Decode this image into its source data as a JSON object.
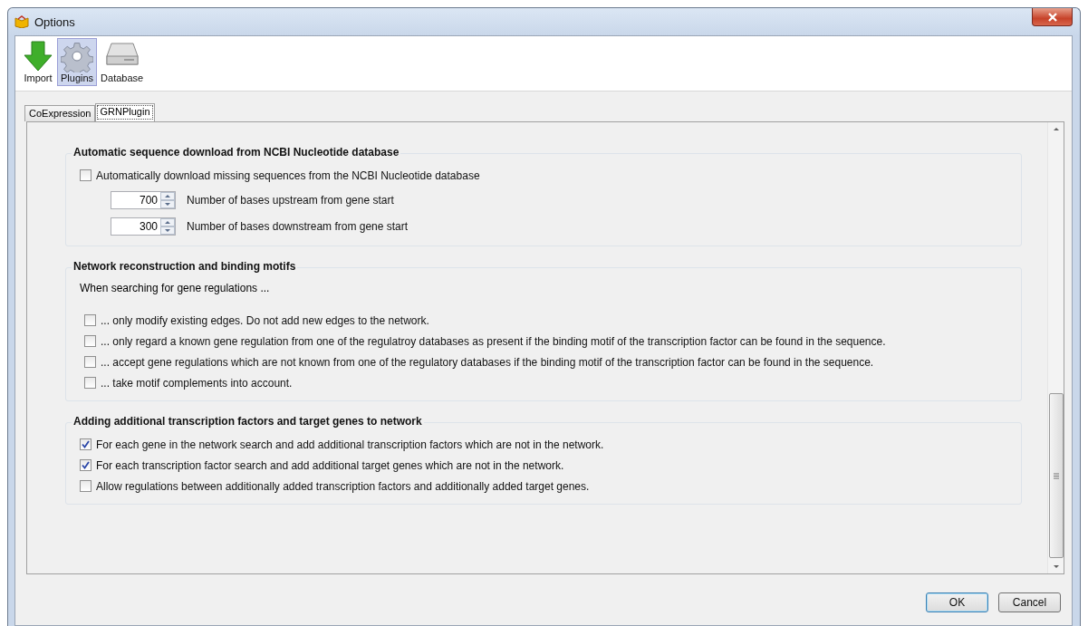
{
  "window": {
    "title": "Options"
  },
  "toolbar": [
    {
      "label": "Import",
      "kind": "import",
      "selected": false
    },
    {
      "label": "Plugins",
      "kind": "plugins",
      "selected": true
    },
    {
      "label": "Database",
      "kind": "database",
      "selected": false
    }
  ],
  "tabs": [
    {
      "label": "CoExpression",
      "selected": false
    },
    {
      "label": "GRNPlugin",
      "selected": true
    }
  ],
  "groups": [
    {
      "title": "Automatic sequence download from NCBI Nucleotide database",
      "items": [
        {
          "kind": "checkbox",
          "label": "Automatically download missing sequences from the NCBI Nucleotide database",
          "checked": false
        },
        {
          "kind": "spin",
          "value": "700",
          "label": "Number of bases upstream from gene start"
        },
        {
          "kind": "spin",
          "value": "300",
          "label": "Number of bases downstream from gene start"
        }
      ]
    },
    {
      "title": "Network reconstruction and binding motifs",
      "items": [
        {
          "kind": "note",
          "label": "When searching for gene regulations ..."
        },
        {
          "kind": "checkbox",
          "label": "... only modify existing edges. Do not add new edges to the network.",
          "checked": false
        },
        {
          "kind": "checkbox",
          "label": "... only regard a known gene regulation from one of the regulatroy databases as present if the binding motif of the transcription factor can be found in the sequence.",
          "checked": false
        },
        {
          "kind": "checkbox",
          "label": "... accept gene regulations which are not known from one of the regulatory databases if the binding motif of the transcription factor can be found in the sequence.",
          "checked": false
        },
        {
          "kind": "checkbox",
          "label": "... take motif complements into account.",
          "checked": false
        }
      ]
    },
    {
      "title": "Adding additional transcription factors and target genes to network",
      "items": [
        {
          "kind": "checkbox",
          "label": "For each gene in the network search and add additional transcription factors which are not in the network.",
          "checked": true
        },
        {
          "kind": "checkbox",
          "label": "For each transcription factor search and add additional target genes which are not in the network.",
          "checked": true
        },
        {
          "kind": "checkbox",
          "label": "Allow regulations between additionally added transcription factors and additionally added target genes.",
          "checked": false
        }
      ]
    }
  ],
  "buttons": [
    {
      "label": "OK",
      "default": true
    },
    {
      "label": "Cancel",
      "default": false
    }
  ]
}
